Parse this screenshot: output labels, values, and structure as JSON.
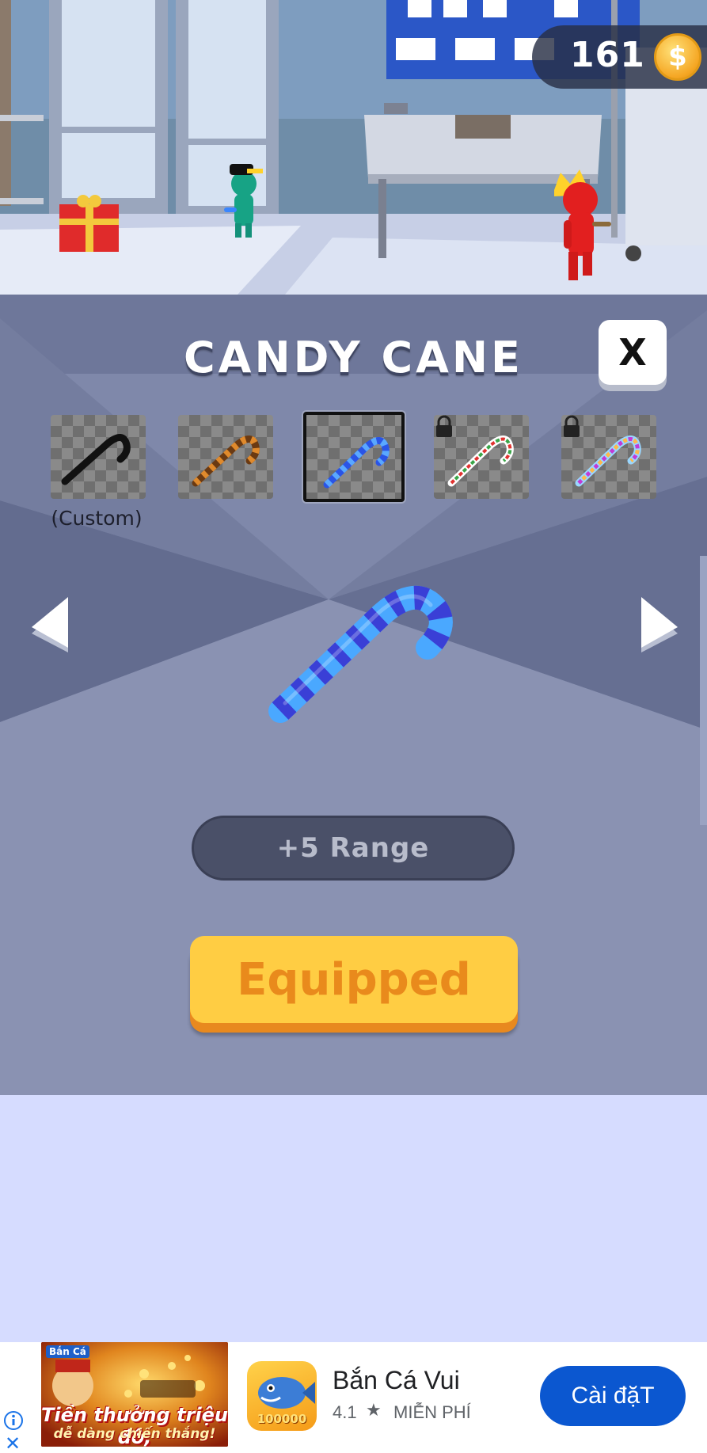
{
  "hud": {
    "coins": "161",
    "coin_symbol": "$"
  },
  "shop": {
    "title": "CANDY CANE",
    "close_label": "X",
    "skins": [
      {
        "label": "(Custom)",
        "colors": [
          "#111111",
          "#111111"
        ],
        "locked": false,
        "selected": false
      },
      {
        "label": "",
        "colors": [
          "#6b3a12",
          "#e08a2c"
        ],
        "locked": false,
        "selected": false
      },
      {
        "label": "",
        "colors": [
          "#2a54e6",
          "#5aa8ff"
        ],
        "locked": false,
        "selected": true
      },
      {
        "label": "",
        "colors": [
          "#e0322f",
          "#3aa548"
        ],
        "locked": true,
        "selected": false
      },
      {
        "label": "",
        "colors": [
          "#c23ad6",
          "#ffb74a"
        ],
        "locked": true,
        "selected": false
      }
    ],
    "preview_colors": [
      "#4aa8ff",
      "#3a3fd6"
    ],
    "stat": "+5 Range",
    "action": "Equipped"
  },
  "ad": {
    "thumb_brand": "Bắn Cá",
    "thumb_slogan_1": "Tiền thưởng triệu đô,",
    "thumb_slogan_2": "dễ dàng chiến thắng!",
    "icon_badge": "100000",
    "app_name": "Bắn Cá Vui",
    "rating": "4.1",
    "price": "MIỄN PHÍ",
    "install_label": "Cài đặT",
    "info_icon": "info-icon",
    "close_icon": "close-icon"
  },
  "colors": {
    "panel": "#7d86a8",
    "equip_button": "#ffcd43",
    "equip_text": "#e98a1c",
    "install_button": "#0b57d0"
  }
}
